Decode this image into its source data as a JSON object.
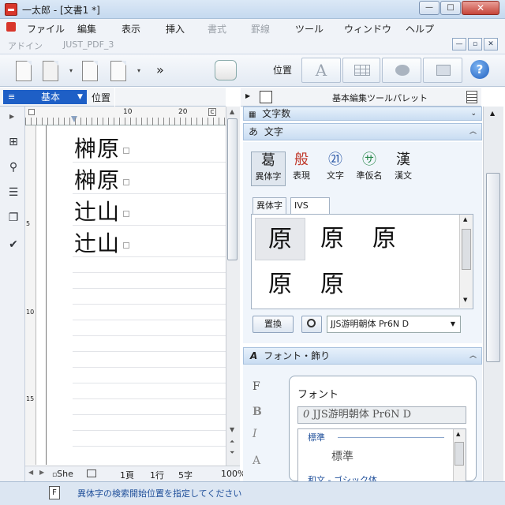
{
  "window": {
    "title": "一太郎 - [文書1 *]",
    "minimize": "—",
    "maximize": "□",
    "close": "✕"
  },
  "menu": [
    {
      "label": "ファイル",
      "disabled": false
    },
    {
      "label": "編集",
      "disabled": false
    },
    {
      "label": "表示",
      "disabled": false
    },
    {
      "label": "挿入",
      "disabled": false
    },
    {
      "label": "書式",
      "disabled": true
    },
    {
      "label": "罫線",
      "disabled": true
    },
    {
      "label": "ツール",
      "disabled": false
    },
    {
      "label": "ウィンドウ",
      "disabled": false
    },
    {
      "label": "ヘルプ",
      "disabled": false
    }
  ],
  "menu2": [
    "アドイン",
    "JUST_PDF_3"
  ],
  "mdi_buttons": [
    "—",
    "▫",
    "✕"
  ],
  "toolbar": {
    "more": "»",
    "position_label": "位置",
    "help": "?"
  },
  "left_header": {
    "style_select": "基本",
    "position_tab": "位置"
  },
  "ruler": {
    "marks": [
      "10",
      "20"
    ],
    "left_marks": [
      "5",
      "10",
      "15"
    ]
  },
  "document": {
    "lines": [
      "榊原",
      "榊原",
      "辻山",
      "辻山"
    ]
  },
  "statusbar": {
    "sheet": "She",
    "page": "1頁",
    "line": "1行",
    "chars": "5字",
    "zoom": "100%"
  },
  "right_panel": {
    "header": "基本編集ツールパレット",
    "section_wordcount": "文字数",
    "section_moji": "文字",
    "moji_buttons": [
      {
        "glyph": "葛",
        "label": "異体字"
      },
      {
        "glyph": "般",
        "label": "表現"
      },
      {
        "glyph": "㉑",
        "label": "文字"
      },
      {
        "glyph": "㋚",
        "label": "準仮名"
      },
      {
        "glyph": "漢",
        "label": "漢文"
      }
    ],
    "tabs": [
      "異体字",
      "IVS"
    ],
    "glyphs": [
      "原",
      "原",
      "原",
      "原",
      "原"
    ],
    "replace_button": "置換",
    "font_select": "JJS游明朝体 Pr6N D",
    "section_font": "フォント・飾り",
    "font_side_icons": [
      "F",
      "B",
      "I",
      "A"
    ],
    "balloon": {
      "title": "フォント",
      "current_font": "JJS游明朝体 Pr6N D",
      "group_header": "標準",
      "item": "標準",
      "next_group": "和文 - ゴシック体"
    }
  },
  "bottom": {
    "status": "異体字の検索開始位置を指定してください",
    "badge": "F"
  }
}
